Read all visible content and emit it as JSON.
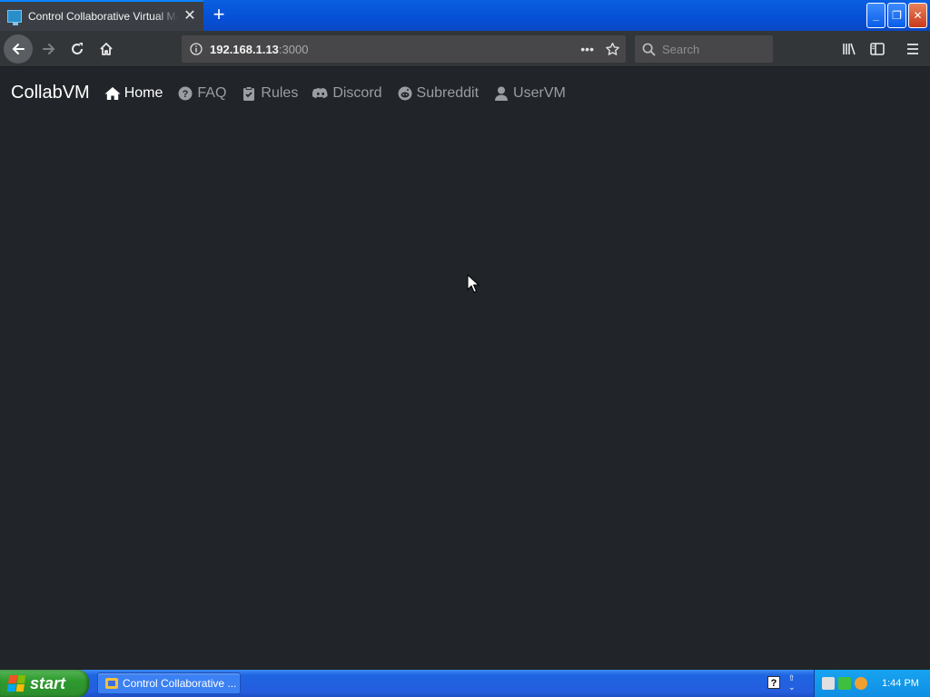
{
  "browser": {
    "tab_title": "Control Collaborative Virtual Machine",
    "new_tab_label": "+",
    "tab_close_label": "✕",
    "url_host": "192.168.1.13",
    "url_port": ":3000",
    "page_actions_label": "•••",
    "search_placeholder": "Search",
    "window_buttons": {
      "minimize": "_",
      "restore": "❐",
      "close": "✕"
    }
  },
  "page": {
    "brand": "CollabVM",
    "nav": [
      {
        "label": "Home",
        "icon": "home-icon",
        "active": true
      },
      {
        "label": "FAQ",
        "icon": "question-circle-icon",
        "active": false
      },
      {
        "label": "Rules",
        "icon": "clipboard-check-icon",
        "active": false
      },
      {
        "label": "Discord",
        "icon": "discord-icon",
        "active": false
      },
      {
        "label": "Subreddit",
        "icon": "reddit-icon",
        "active": false
      },
      {
        "label": "UserVM",
        "icon": "user-icon",
        "active": false
      }
    ],
    "background_color": "#212529"
  },
  "taskbar": {
    "start_label": "start",
    "task_button_label": "Control Collaborative ...",
    "help_label": "?",
    "clock": "1:44 PM"
  }
}
